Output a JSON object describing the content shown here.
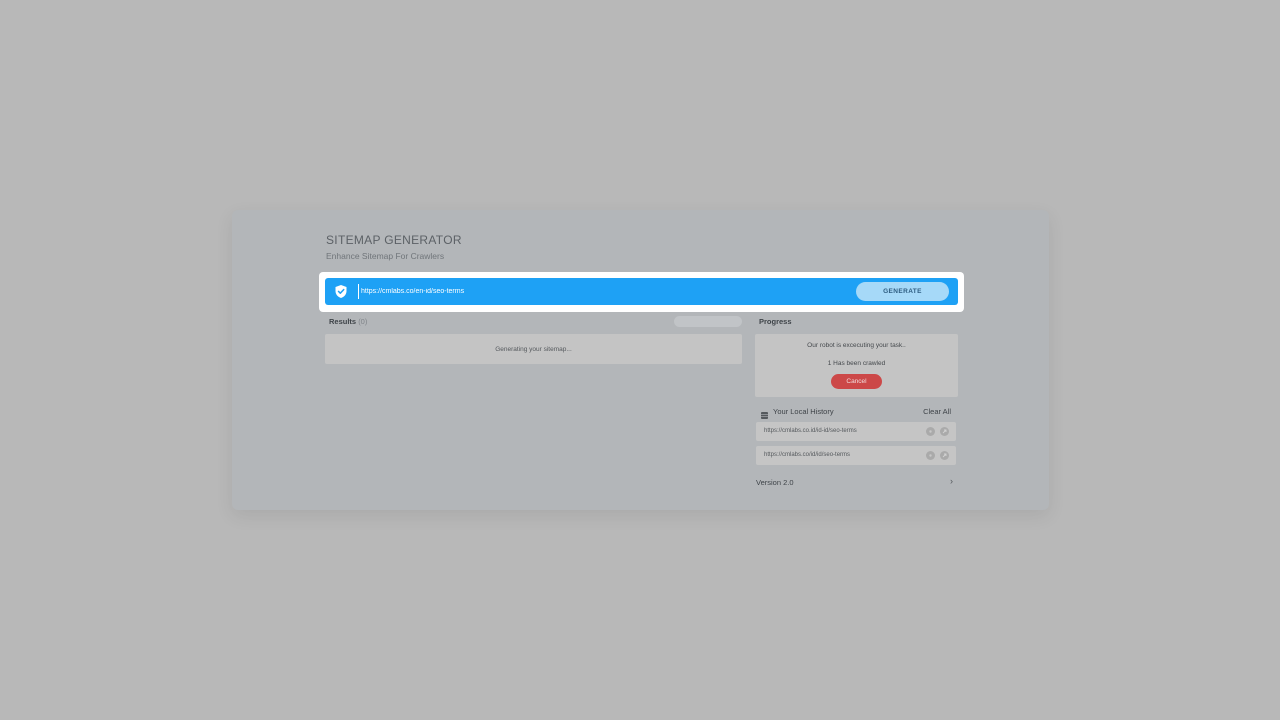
{
  "header": {
    "title": "SITEMAP GENERATOR",
    "subtitle": "Enhance Sitemap For Crawlers"
  },
  "url_bar": {
    "value": "https://cmlabs.co/en-id/seo-terms",
    "icon": "shield-check-icon",
    "generate_label": "GENERATE",
    "accent_color": "#1ea1f5"
  },
  "results": {
    "label": "Results",
    "count": "(0)",
    "status_text": "Generating your sitemap..."
  },
  "progress": {
    "label": "Progress",
    "robot_text": "Our robot is excecuting your task..",
    "crawled_text": "1 Has been crawled",
    "cancel_label": "Cancel",
    "cancel_color": "#cc4848"
  },
  "history": {
    "title": "Your Local History",
    "clear_label": "Clear All",
    "items": [
      {
        "url": "https://cmlabs.co.id/id-id/seo-terms"
      },
      {
        "url": "https://cmlabs.co/id/id/seo-terms"
      }
    ]
  },
  "footer": {
    "version": "Version 2.0",
    "chevron_icon": "chevron-right-icon"
  }
}
